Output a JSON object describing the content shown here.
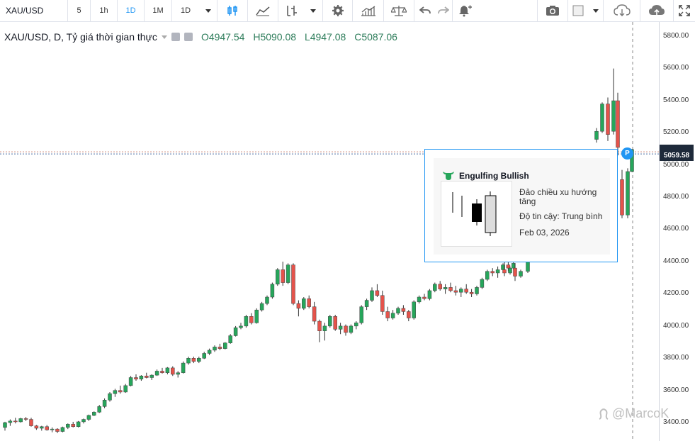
{
  "toolbar": {
    "symbol": "XAU/USD",
    "intervals": [
      "5",
      "1h",
      "1D",
      "1M",
      "1D"
    ],
    "active_interval_index": 2
  },
  "legend": {
    "title": "XAU/USD, D, Tỷ giá thời gian thực",
    "open": "O4947.54",
    "high": "H5090.08",
    "low": "L4947.08",
    "close": "C5087.06"
  },
  "price_axis": {
    "labels": [
      "5800.00",
      "5600.00",
      "5400.00",
      "5200.00",
      "5000.00",
      "4800.00",
      "4600.00",
      "4400.00",
      "4200.00",
      "4000.00",
      "3800.00",
      "3600.00",
      "3400.00"
    ],
    "current_price": "5059.58"
  },
  "popup": {
    "title": "Engulfing Bullish",
    "description": "Đảo chiều xu hướng tăng",
    "confidence": "Độ tin cậy: Trung bình",
    "date": "Feb 03, 2026"
  },
  "marker": {
    "label": "P"
  },
  "watermark": {
    "text": "@MarcoK"
  },
  "colors": {
    "up": "#26a65b",
    "down": "#e5534b",
    "accent": "#2196f3"
  },
  "chart_data": {
    "type": "candlestick",
    "y_range": [
      3300,
      5900
    ],
    "candles": [
      [
        3360,
        3395,
        3340,
        3390
      ],
      [
        3390,
        3410,
        3370,
        3400
      ],
      [
        3400,
        3420,
        3385,
        3395
      ],
      [
        3395,
        3420,
        3390,
        3415
      ],
      [
        3415,
        3425,
        3400,
        3410
      ],
      [
        3410,
        3420,
        3365,
        3370
      ],
      [
        3370,
        3375,
        3345,
        3355
      ],
      [
        3355,
        3370,
        3340,
        3365
      ],
      [
        3365,
        3375,
        3340,
        3345
      ],
      [
        3345,
        3360,
        3330,
        3350
      ],
      [
        3350,
        3355,
        3325,
        3335
      ],
      [
        3335,
        3365,
        3330,
        3360
      ],
      [
        3360,
        3385,
        3350,
        3380
      ],
      [
        3380,
        3395,
        3360,
        3365
      ],
      [
        3365,
        3400,
        3360,
        3395
      ],
      [
        3395,
        3415,
        3385,
        3410
      ],
      [
        3410,
        3440,
        3400,
        3435
      ],
      [
        3435,
        3460,
        3430,
        3455
      ],
      [
        3455,
        3500,
        3450,
        3490
      ],
      [
        3490,
        3540,
        3480,
        3530
      ],
      [
        3530,
        3580,
        3520,
        3570
      ],
      [
        3570,
        3600,
        3550,
        3590
      ],
      [
        3590,
        3620,
        3570,
        3580
      ],
      [
        3580,
        3630,
        3575,
        3620
      ],
      [
        3620,
        3680,
        3615,
        3670
      ],
      [
        3670,
        3690,
        3650,
        3660
      ],
      [
        3660,
        3685,
        3650,
        3680
      ],
      [
        3680,
        3700,
        3665,
        3670
      ],
      [
        3670,
        3690,
        3655,
        3685
      ],
      [
        3685,
        3720,
        3680,
        3710
      ],
      [
        3710,
        3730,
        3695,
        3700
      ],
      [
        3700,
        3735,
        3690,
        3730
      ],
      [
        3730,
        3740,
        3680,
        3690
      ],
      [
        3690,
        3710,
        3670,
        3700
      ],
      [
        3700,
        3770,
        3695,
        3760
      ],
      [
        3760,
        3800,
        3750,
        3790
      ],
      [
        3790,
        3800,
        3760,
        3770
      ],
      [
        3770,
        3800,
        3760,
        3790
      ],
      [
        3790,
        3830,
        3785,
        3820
      ],
      [
        3820,
        3850,
        3810,
        3840
      ],
      [
        3840,
        3870,
        3830,
        3860
      ],
      [
        3860,
        3880,
        3840,
        3850
      ],
      [
        3850,
        3890,
        3845,
        3885
      ],
      [
        3885,
        3940,
        3880,
        3930
      ],
      [
        3930,
        3990,
        3925,
        3980
      ],
      [
        3980,
        4010,
        3970,
        3990
      ],
      [
        3990,
        4060,
        3980,
        4050
      ],
      [
        4050,
        4070,
        4000,
        4010
      ],
      [
        4010,
        4100,
        4005,
        4090
      ],
      [
        4090,
        4140,
        4080,
        4130
      ],
      [
        4130,
        4180,
        4120,
        4170
      ],
      [
        4170,
        4260,
        4160,
        4250
      ],
      [
        4250,
        4350,
        4240,
        4340
      ],
      [
        4340,
        4390,
        4240,
        4260
      ],
      [
        4260,
        4380,
        4250,
        4370
      ],
      [
        4370,
        4380,
        4120,
        4130
      ],
      [
        4130,
        4150,
        4050,
        4100
      ],
      [
        4100,
        4170,
        4090,
        4160
      ],
      [
        4160,
        4180,
        4100,
        4110
      ],
      [
        4110,
        4140,
        4000,
        4020
      ],
      [
        4020,
        4030,
        3890,
        3960
      ],
      [
        3960,
        4010,
        3900,
        3990
      ],
      [
        3990,
        4060,
        3980,
        4050
      ],
      [
        4050,
        4060,
        3960,
        3970
      ],
      [
        3970,
        4010,
        3940,
        3990
      ],
      [
        3990,
        4000,
        3930,
        3950
      ],
      [
        3950,
        4000,
        3940,
        3990
      ],
      [
        3990,
        4020,
        3970,
        4010
      ],
      [
        4010,
        4120,
        4000,
        4110
      ],
      [
        4110,
        4160,
        4090,
        4150
      ],
      [
        4150,
        4230,
        4140,
        4210
      ],
      [
        4210,
        4250,
        4170,
        4180
      ],
      [
        4180,
        4210,
        4060,
        4080
      ],
      [
        4080,
        4110,
        4020,
        4040
      ],
      [
        4040,
        4090,
        4030,
        4070
      ],
      [
        4070,
        4110,
        4060,
        4100
      ],
      [
        4100,
        4120,
        4060,
        4080
      ],
      [
        4080,
        4090,
        4020,
        4040
      ],
      [
        4040,
        4150,
        4030,
        4140
      ],
      [
        4140,
        4180,
        4130,
        4170
      ],
      [
        4170,
        4190,
        4150,
        4160
      ],
      [
        4160,
        4220,
        4150,
        4210
      ],
      [
        4210,
        4260,
        4200,
        4250
      ],
      [
        4250,
        4270,
        4210,
        4220
      ],
      [
        4220,
        4250,
        4190,
        4230
      ],
      [
        4230,
        4260,
        4200,
        4210
      ],
      [
        4210,
        4240,
        4180,
        4200
      ],
      [
        4200,
        4230,
        4170,
        4220
      ],
      [
        4220,
        4250,
        4190,
        4200
      ],
      [
        4200,
        4220,
        4170,
        4190
      ],
      [
        4190,
        4240,
        4180,
        4230
      ],
      [
        4230,
        4290,
        4220,
        4280
      ],
      [
        4280,
        4340,
        4270,
        4330
      ],
      [
        4330,
        4350,
        4300,
        4320
      ],
      [
        4320,
        4360,
        4290,
        4340
      ],
      [
        4340,
        4380,
        4320,
        4370
      ],
      [
        4370,
        4390,
        4330,
        4350
      ],
      [
        4350,
        4420,
        4340,
        4380
      ]
    ],
    "popup_candles_hidden_note": null
  }
}
